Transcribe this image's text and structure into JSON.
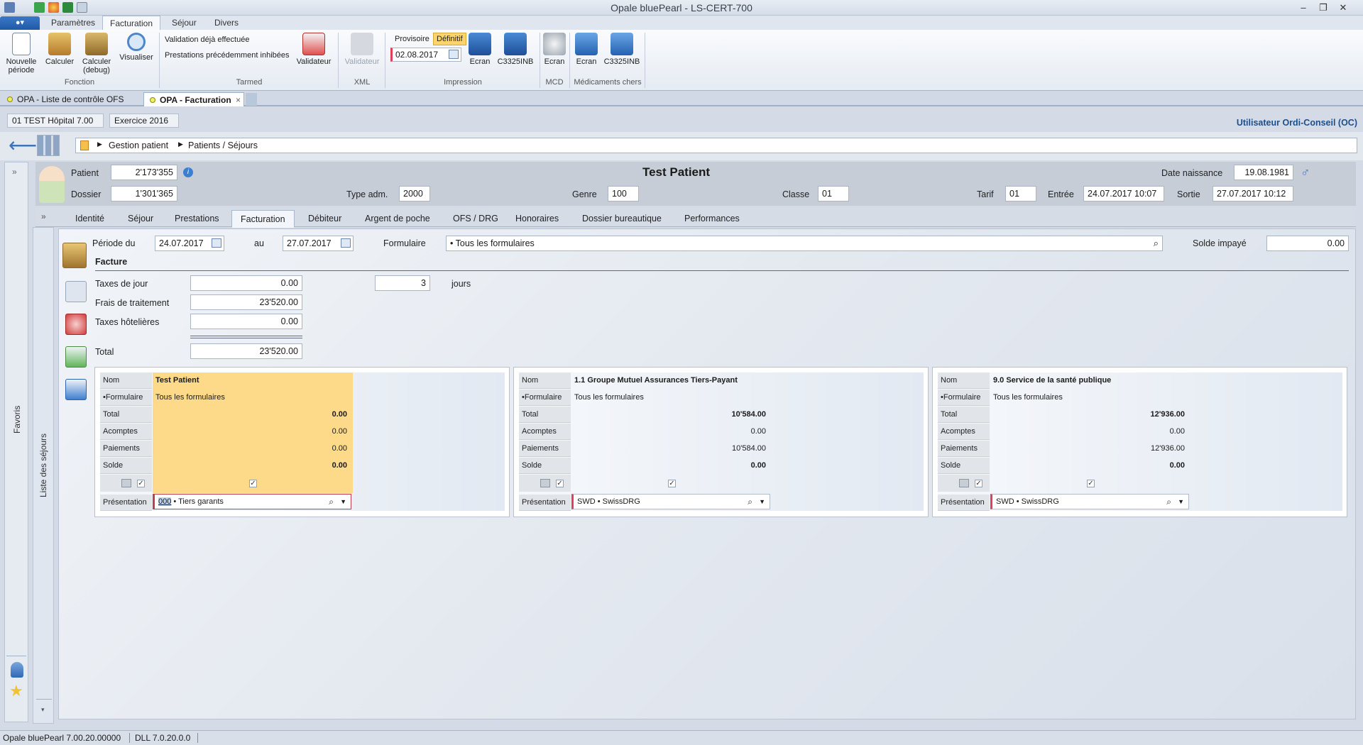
{
  "window": {
    "title": "Opale bluePearl   -   LS-CERT-700"
  },
  "ribbon": {
    "file_label": "",
    "tabs": [
      "Paramètres",
      "Facturation",
      "Séjour",
      "Divers"
    ],
    "fonction": {
      "label": "Fonction",
      "nouvelle_periode": "Nouvelle période",
      "calculer": "Calculer",
      "calculer_debug": "Calculer (debug)",
      "visualiser": "Visualiser"
    },
    "tarmed": {
      "label": "Tarmed",
      "validation": "Validation déjà effectuée",
      "prestations": "Prestations précédemment inhibées",
      "validateur": "Validateur"
    },
    "xml": {
      "label": "XML",
      "validateur": "Validateur"
    },
    "impression": {
      "label": "Impression",
      "provisoire": "Provisoire",
      "definitif": "Définitif",
      "date": "02.08.2017",
      "ecran": "Ecran",
      "c3325": "C3325INB"
    },
    "mcd": {
      "label": "MCD",
      "ecran": "Ecran"
    },
    "medicaments": {
      "label": "Médicaments chers",
      "ecran": "Ecran",
      "c3325": "C3325INB"
    }
  },
  "doc_tabs": [
    {
      "label": "OPA - Liste de contrôle OFS"
    },
    {
      "label": "OPA - Facturation"
    }
  ],
  "info": {
    "hospital": "01 TEST Hôpital 7.00",
    "exercice": "Exercice 2016",
    "user": "Utilisateur Ordi-Conseil (OC)"
  },
  "breadcrumb": [
    "Gestion patient",
    "Patients / Séjours"
  ],
  "patient": {
    "name": "Test Patient",
    "patient_label": "Patient",
    "patient_no": "2'173'355",
    "dossier_label": "Dossier",
    "dossier_no": "1'301'365",
    "type_adm_label": "Type adm.",
    "type_adm": "2000",
    "genre_label": "Genre",
    "genre": "100",
    "classe_label": "Classe",
    "classe": "01",
    "tarif_label": "Tarif",
    "tarif": "01",
    "entree_label": "Entrée",
    "entree": "24.07.2017 10:07",
    "sortie_label": "Sortie",
    "sortie": "27.07.2017 10:12",
    "naissance_label": "Date naissance",
    "naissance": "19.08.1981"
  },
  "content_tabs": [
    "Identité",
    "Séjour",
    "Prestations",
    "Facturation",
    "Débiteur",
    "Argent de poche",
    "OFS / DRG",
    "Honoraires",
    "Dossier bureautique",
    "Performances"
  ],
  "sidebars": {
    "favoris": "Favoris",
    "sejours": "Liste des séjours"
  },
  "facturation": {
    "periode_label": "Période du",
    "periode_du": "24.07.2017",
    "au_label": "au",
    "periode_au": "27.07.2017",
    "formulaire_label": "Formulaire",
    "formulaire": "• Tous les formulaires",
    "solde_label": "Solde impayé",
    "solde": "0.00",
    "section": "Facture",
    "taxes_jour_label": "Taxes de jour",
    "taxes_jour": "0.00",
    "jours_value": "3",
    "jours_label": "jours",
    "frais_label": "Frais de traitement",
    "frais": "23'520.00",
    "hotel_label": "Taxes hôtelières",
    "hotel": "0.00",
    "total_label": "Total",
    "total": "23'520.00"
  },
  "card_labels": {
    "nom": "Nom",
    "formulaire": "•Formulaire",
    "total": "Total",
    "acomptes": "Acomptes",
    "paiements": "Paiements",
    "solde": "Solde",
    "presentation": "Présentation"
  },
  "cards": [
    {
      "nom": "Test Patient",
      "formulaire": "Tous les formulaires",
      "total": "0.00",
      "acomptes": "0.00",
      "paiements": "0.00",
      "solde": "0.00",
      "presentation_code": "000",
      "presentation": " • Tiers garants"
    },
    {
      "nom": "1.1 Groupe Mutuel Assurances Tiers-Payant",
      "formulaire": "Tous les formulaires",
      "total": "10'584.00",
      "acomptes": "0.00",
      "paiements": "10'584.00",
      "solde": "0.00",
      "presentation": "SWD • SwissDRG"
    },
    {
      "nom": "9.0 Service de la santé publique",
      "formulaire": "Tous les formulaires",
      "total": "12'936.00",
      "acomptes": "0.00",
      "paiements": "12'936.00",
      "solde": "0.00",
      "presentation": "SWD • SwissDRG"
    }
  ],
  "status": {
    "version": "Opale bluePearl 7.00.20.00000",
    "dll": "DLL 7.0.20.0.0"
  },
  "colors": {
    "accent": "#1f5aa6",
    "highlight_card": "#fdd98a",
    "definitif": "#fbd56b"
  }
}
